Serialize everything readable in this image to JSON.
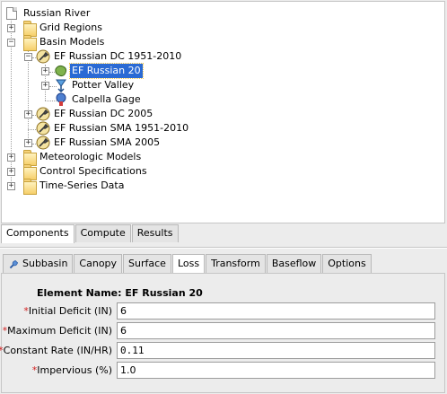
{
  "tree": {
    "root": "Russian River",
    "grid_regions": "Grid Regions",
    "basin_models": "Basin Models",
    "basin_model_items": [
      "EF Russian DC 1951-2010",
      "EF Russian DC 2005",
      "EF Russian SMA 1951-2010",
      "EF Russian SMA 2005"
    ],
    "elements": [
      "EF Russian 20",
      "Potter Valley",
      "Calpella Gage"
    ],
    "meteorologic_models": "Meteorologic Models",
    "control_specifications": "Control Specifications",
    "time_series_data": "Time-Series Data",
    "selected": "EF Russian 20"
  },
  "main_tabs": [
    "Components",
    "Compute",
    "Results"
  ],
  "element_tabs": [
    "Subbasin",
    "Canopy",
    "Surface",
    "Loss",
    "Transform",
    "Baseflow",
    "Options"
  ],
  "active_element_tab": "Loss",
  "properties": {
    "element_name_label": "Element Name:",
    "element_name_value": "EF Russian 20",
    "fields": [
      {
        "label": "Initial Deficit (IN)",
        "value": "6",
        "required": true
      },
      {
        "label": "Maximum Deficit (IN)",
        "value": "6",
        "required": true
      },
      {
        "label": "Constant Rate (IN/HR)",
        "value": "0.11",
        "required": true
      },
      {
        "label": "Impervious (%)",
        "value": "1.0",
        "required": true
      }
    ],
    "required_marker": "*"
  },
  "colors": {
    "selection": "#2a6ad4",
    "required_star": "#d21f1f",
    "folder": "#f5d27a"
  }
}
